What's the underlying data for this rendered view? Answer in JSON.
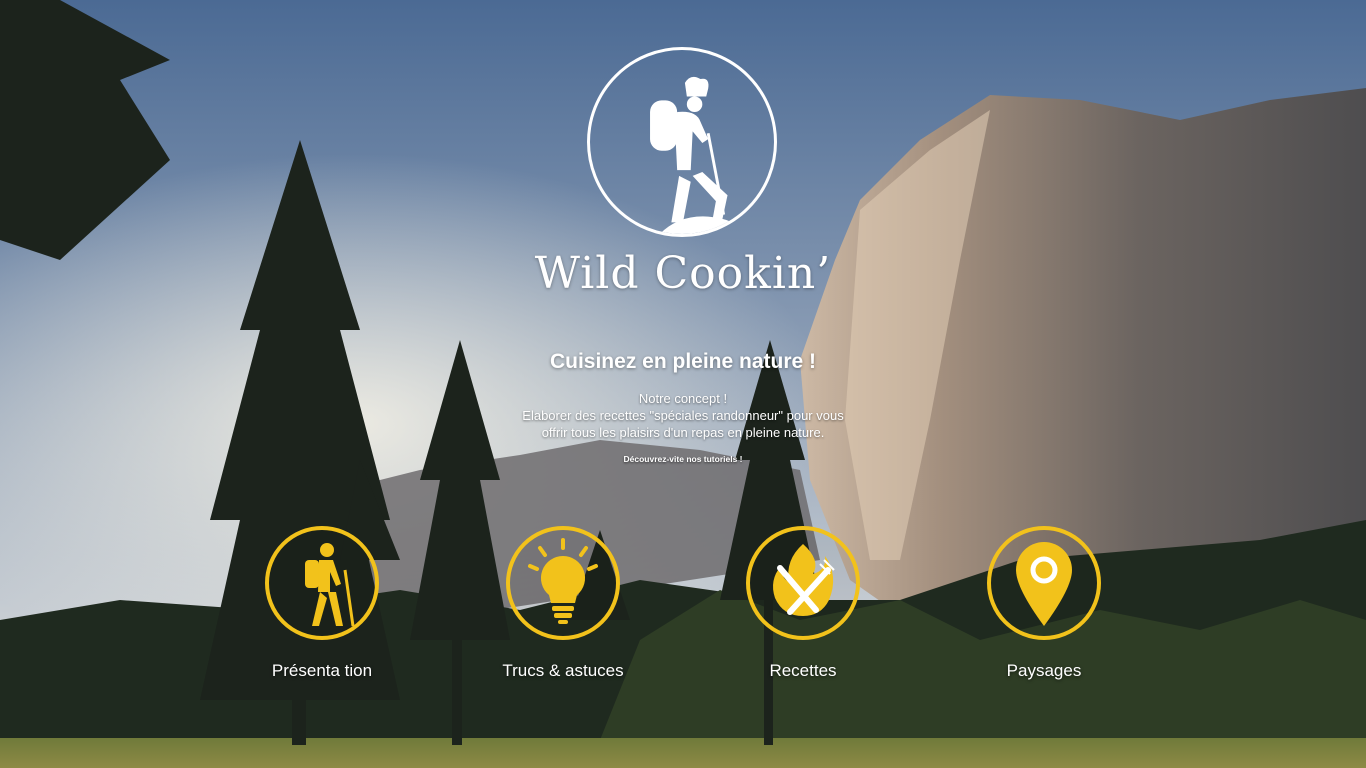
{
  "brand": {
    "logo_icon": "chef-hiker-icon",
    "name": "Wild Cookin’"
  },
  "hero": {
    "title": "Cuisinez en pleine nature !",
    "concept_line1": "Notre concept !",
    "concept_line2": "Elaborer des recettes \"spéciales randonneur\" pour vous",
    "concept_line3": "offrir tous les plaisirs d'un repas en pleine nature.",
    "cta": "Découvrez-vite nos tutoriels !"
  },
  "nav": {
    "items": [
      {
        "label": "Présenta tion",
        "icon": "hiker-icon"
      },
      {
        "label": "Trucs & astuces",
        "icon": "lightbulb-icon"
      },
      {
        "label": "Recettes",
        "icon": "fire-cutlery-icon"
      },
      {
        "label": "Paysages",
        "icon": "map-pin-icon"
      }
    ]
  },
  "colors": {
    "accent": "#f2c21b",
    "text": "#ffffff",
    "sky": "#4b6a94"
  }
}
